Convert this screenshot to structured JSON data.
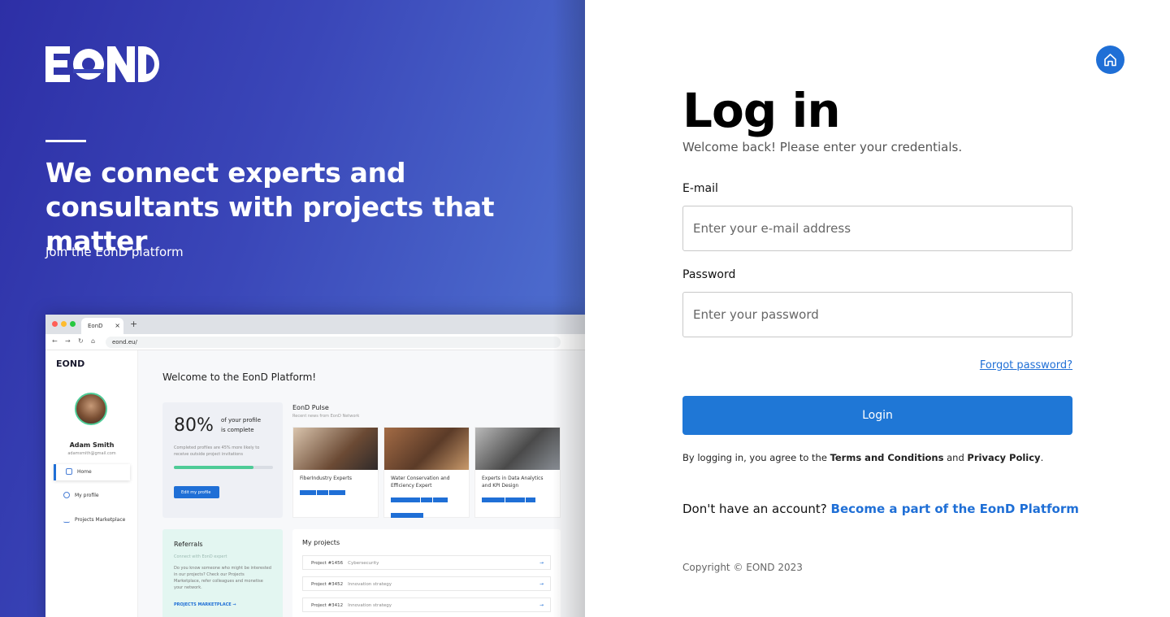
{
  "brand": {
    "logo_text": "EOND"
  },
  "hero": {
    "headline": "We connect experts and consultants with projects that matter",
    "subtext": "Join the EonD platform"
  },
  "mockup": {
    "tab_title": "EonD",
    "tab_close": "×",
    "new_tab": "+",
    "url": "eond.eu/",
    "sidebar": {
      "logo": "EOND",
      "user_name": "Adam Smith",
      "user_email": "adamsmith@gmail.com",
      "items": [
        {
          "label": "Home"
        },
        {
          "label": "My profile"
        },
        {
          "label": "Projects Marketplace"
        }
      ]
    },
    "welcome": "Welcome to the EonD Platform!",
    "profile_card": {
      "percent": "80%",
      "caption_line1": "of your profile",
      "caption_line2": "is complete",
      "description": "Completed profiles are 45% more likely to receive outside project invitations",
      "progress": 0.8,
      "button": "Edit my profile"
    },
    "pulse": {
      "title": "EonD Pulse",
      "subtitle": "Recent news from EonD Network",
      "cards": [
        {
          "title": "FiberIndustry Experts"
        },
        {
          "title": "Water Conservation and Efficiency Expert"
        },
        {
          "title": "Experts in Data Analytics and KPI Design"
        }
      ]
    },
    "referrals": {
      "title": "Referrals",
      "subtitle": "Connect with EonD expert",
      "description": "Do you know someone who might be interested in our projects? Check our Projects Marketplace, refer colleagues and monetise your network.",
      "link": "PROJECTS MARKETPLACE →"
    },
    "projects": {
      "title": "My projects",
      "rows": [
        {
          "id": "Project #1456",
          "topic": "Cybersecurity"
        },
        {
          "id": "Project #3452",
          "topic": "Innovation strategy"
        },
        {
          "id": "Project #3412",
          "topic": "Innovation strategy"
        }
      ],
      "arrow": "→"
    }
  },
  "login": {
    "title": "Log in",
    "welcome": "Welcome back! Please enter your credentials.",
    "email_label": "E-mail",
    "email_placeholder": "Enter your e-mail address",
    "password_label": "Password",
    "password_placeholder": "Enter your password",
    "forgot": "Forgot password?",
    "button": "Login",
    "terms_prefix": "By logging in, you agree to the ",
    "terms_link": "Terms and Conditions",
    "terms_and": " and ",
    "privacy_link": "Privacy Policy",
    "terms_suffix": ".",
    "signup_prefix": "Don't have an account? ",
    "signup_link": "Become a part of the EonD Platform",
    "copyright": "Copyright © EOND 2023"
  },
  "colors": {
    "accent": "#1f77d6",
    "panel_start": "#2d2fa6",
    "panel_end": "#4f70d0",
    "success": "#4ecb97"
  },
  "icons": {
    "home": "home-icon"
  }
}
